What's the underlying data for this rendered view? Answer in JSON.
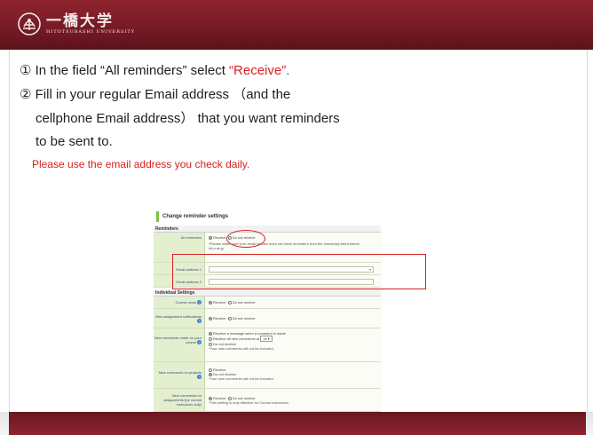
{
  "header": {
    "logo_jp": "一橋大学",
    "logo_en": "HITOTSUBASHI UNIVERSITY"
  },
  "instructions": {
    "step1_num": "①",
    "step1_text": " In the field “All reminders” select ",
    "step1_highlight": "“Receive”.",
    "step2_num": "②",
    "step2_line1": " Fill in your regular Email address （and the",
    "step2_line2": "cellphone Email address） that you want reminders",
    "step2_line3": "to be sent to.",
    "note": "Please use the email address you check daily."
  },
  "screenshot": {
    "title": "Change reminder settings",
    "section_reminders": "Reminders",
    "all_reminders_label": "All reminders",
    "receive": "Receive",
    "do_not_receive": "Do not receive",
    "all_reminders_note": "*Please make sure your email service does not block reminders from the domain(s) listed below:",
    "domain": "hit-u.ac.jp",
    "email1_label": "Email address 1",
    "email2_label": "Email address 2",
    "section_individual": "Individual Settings",
    "course_news_label": "Course news",
    "new_assign_label": "New assignment notifications",
    "new_comments_label": "New comments made on your course",
    "opt_receive_msg": "Receive a message when a comment is made",
    "opt_receive_all": "Receive all new comments at",
    "opt_time": "18",
    "opt_own_not_included": "*Your own comments will not be included.",
    "new_projects_label": "New comments on projects",
    "new_assign_comments_label": "New comments on assignments (for course instructors only)",
    "course_instr_note": "*This setting is only effective for Course instructors."
  }
}
